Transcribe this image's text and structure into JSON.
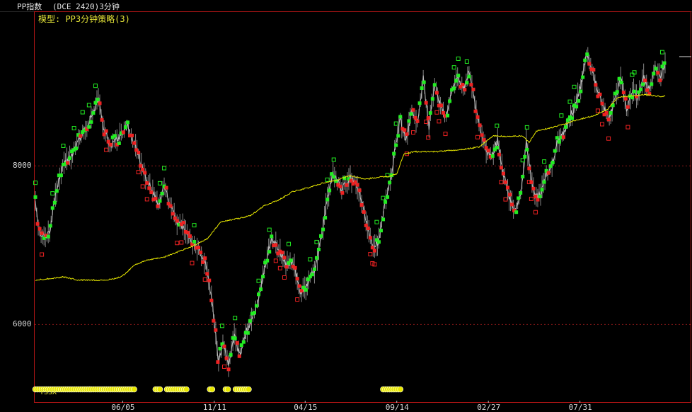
{
  "header": {
    "instrument": "PP指数",
    "contract_period": "(DCE 2420)3分钟"
  },
  "subtitle": "模型: PP3分钟策略(3)",
  "indicator_label": "TSSX",
  "colors": {
    "background": "#000000",
    "frame": "#b01515",
    "grid": "#8a1a1a",
    "price_line": "#bfbfbf",
    "avg_line": "#e8e800",
    "buy_marker": "#22ee22",
    "sell_marker": "#ee2222",
    "signal_dot": "#e8e800"
  },
  "chart_data": {
    "type": "line",
    "title": "",
    "xlabel": "",
    "ylabel": "",
    "ylim": [
      5200,
      9950
    ],
    "yticks": [
      6000,
      8000
    ],
    "grid": "horizontal dotted",
    "xticks": [
      {
        "label": "06/05",
        "index": 122
      },
      {
        "label": "11/11",
        "index": 250
      },
      {
        "label": "04/15",
        "index": 377
      },
      {
        "label": "09/14",
        "index": 505
      },
      {
        "label": "02/27",
        "index": 633
      },
      {
        "label": "07/31",
        "index": 761
      }
    ],
    "series": [
      {
        "style": "price",
        "keypoints": [
          [
            0,
            7550
          ],
          [
            4,
            7200
          ],
          [
            12,
            7100
          ],
          [
            20,
            7150
          ],
          [
            28,
            7650
          ],
          [
            38,
            8000
          ],
          [
            48,
            8100
          ],
          [
            62,
            8350
          ],
          [
            75,
            8550
          ],
          [
            88,
            8850
          ],
          [
            95,
            8500
          ],
          [
            104,
            8250
          ],
          [
            115,
            8350
          ],
          [
            128,
            8500
          ],
          [
            140,
            8250
          ],
          [
            152,
            7900
          ],
          [
            164,
            7700
          ],
          [
            172,
            7500
          ],
          [
            180,
            7750
          ],
          [
            188,
            7500
          ],
          [
            198,
            7300
          ],
          [
            210,
            7200
          ],
          [
            222,
            7000
          ],
          [
            232,
            6900
          ],
          [
            240,
            6700
          ],
          [
            248,
            6200
          ],
          [
            256,
            5500
          ],
          [
            262,
            5800
          ],
          [
            270,
            5500
          ],
          [
            278,
            5850
          ],
          [
            286,
            5600
          ],
          [
            294,
            5900
          ],
          [
            302,
            6050
          ],
          [
            312,
            6300
          ],
          [
            320,
            6700
          ],
          [
            330,
            7100
          ],
          [
            340,
            6950
          ],
          [
            350,
            6750
          ],
          [
            360,
            6800
          ],
          [
            370,
            6400
          ],
          [
            380,
            6500
          ],
          [
            390,
            6700
          ],
          [
            400,
            7100
          ],
          [
            408,
            7600
          ],
          [
            416,
            7900
          ],
          [
            428,
            7700
          ],
          [
            440,
            7850
          ],
          [
            452,
            7700
          ],
          [
            462,
            7300
          ],
          [
            472,
            7000
          ],
          [
            480,
            7050
          ],
          [
            488,
            7500
          ],
          [
            496,
            7800
          ],
          [
            504,
            8300
          ],
          [
            510,
            8600
          ],
          [
            518,
            8300
          ],
          [
            526,
            8700
          ],
          [
            534,
            8500
          ],
          [
            542,
            9100
          ],
          [
            550,
            8500
          ],
          [
            558,
            9050
          ],
          [
            566,
            8750
          ],
          [
            574,
            8600
          ],
          [
            582,
            8950
          ],
          [
            590,
            9150
          ],
          [
            598,
            8950
          ],
          [
            606,
            9200
          ],
          [
            614,
            8800
          ],
          [
            622,
            8450
          ],
          [
            630,
            8200
          ],
          [
            638,
            8100
          ],
          [
            646,
            8350
          ],
          [
            654,
            7900
          ],
          [
            662,
            7600
          ],
          [
            670,
            7450
          ],
          [
            678,
            7600
          ],
          [
            686,
            8300
          ],
          [
            692,
            7900
          ],
          [
            698,
            7600
          ],
          [
            706,
            7650
          ],
          [
            714,
            7900
          ],
          [
            722,
            8000
          ],
          [
            730,
            8350
          ],
          [
            738,
            8400
          ],
          [
            746,
            8600
          ],
          [
            754,
            8750
          ],
          [
            762,
            9000
          ],
          [
            770,
            9400
          ],
          [
            778,
            9200
          ],
          [
            786,
            8950
          ],
          [
            794,
            8750
          ],
          [
            802,
            8600
          ],
          [
            810,
            8850
          ],
          [
            818,
            9100
          ],
          [
            826,
            8700
          ],
          [
            834,
            8950
          ],
          [
            842,
            8850
          ],
          [
            850,
            9100
          ],
          [
            858,
            8950
          ],
          [
            866,
            9250
          ],
          [
            874,
            9150
          ],
          [
            880,
            9300
          ]
        ]
      },
      {
        "style": "average",
        "keypoints": [
          [
            0,
            6560
          ],
          [
            20,
            6580
          ],
          [
            40,
            6600
          ],
          [
            60,
            6560
          ],
          [
            80,
            6560
          ],
          [
            100,
            6560
          ],
          [
            120,
            6600
          ],
          [
            140,
            6760
          ],
          [
            160,
            6820
          ],
          [
            180,
            6850
          ],
          [
            200,
            6920
          ],
          [
            220,
            6990
          ],
          [
            240,
            7080
          ],
          [
            260,
            7300
          ],
          [
            280,
            7330
          ],
          [
            300,
            7370
          ],
          [
            320,
            7500
          ],
          [
            340,
            7570
          ],
          [
            360,
            7680
          ],
          [
            380,
            7720
          ],
          [
            400,
            7780
          ],
          [
            420,
            7820
          ],
          [
            440,
            7880
          ],
          [
            460,
            7830
          ],
          [
            480,
            7860
          ],
          [
            495,
            7870
          ],
          [
            505,
            7900
          ],
          [
            515,
            8150
          ],
          [
            530,
            8180
          ],
          [
            560,
            8180
          ],
          [
            600,
            8210
          ],
          [
            620,
            8240
          ],
          [
            640,
            8380
          ],
          [
            660,
            8370
          ],
          [
            680,
            8380
          ],
          [
            690,
            8300
          ],
          [
            700,
            8440
          ],
          [
            720,
            8480
          ],
          [
            740,
            8530
          ],
          [
            760,
            8590
          ],
          [
            780,
            8630
          ],
          [
            800,
            8720
          ],
          [
            815,
            8870
          ],
          [
            830,
            8880
          ],
          [
            850,
            8900
          ],
          [
            870,
            8880
          ],
          [
            880,
            8880
          ]
        ]
      }
    ],
    "signal_dots": [
      {
        "from": 0,
        "to": 140
      },
      {
        "from": 168,
        "to": 175
      },
      {
        "from": 184,
        "to": 212
      },
      {
        "from": 244,
        "to": 248
      },
      {
        "from": 266,
        "to": 270
      },
      {
        "from": 280,
        "to": 300
      },
      {
        "from": 486,
        "to": 510
      }
    ]
  }
}
